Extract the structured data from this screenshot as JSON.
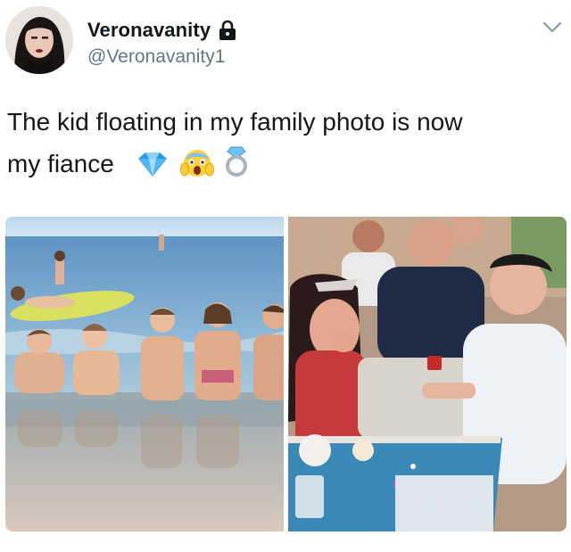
{
  "author": {
    "display_name": "Veronavanity",
    "handle": "@Veronavanity1",
    "protected": true,
    "avatar_icon": "profile-avatar",
    "lock_icon": "lock-icon"
  },
  "menu": {
    "icon": "chevron-down-icon"
  },
  "tweet": {
    "text_line1": "The kid floating in my family photo is now",
    "text_line2": "my fiance",
    "emojis": [
      "gem-emoji",
      "screaming-face-emoji",
      "ring-emoji"
    ]
  },
  "media": {
    "images": [
      {
        "name": "family-beach-photo"
      },
      {
        "name": "proposal-photo"
      }
    ]
  },
  "colors": {
    "text_primary": "#14171a",
    "text_secondary": "#657786",
    "background": "#ffffff"
  }
}
